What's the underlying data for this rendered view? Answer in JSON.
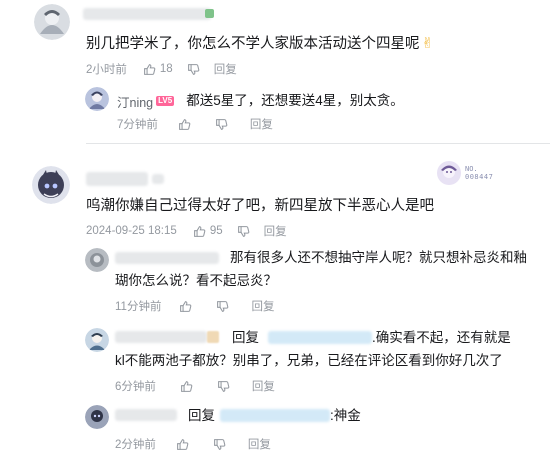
{
  "comments": [
    {
      "text": "别几把学米了，你怎么不学人家版本活动送个四星呢",
      "emoji": "✌",
      "time": "2小时前",
      "likes": "18",
      "reply_label": "回复"
    },
    {
      "text": "呜潮你嫌自己过得太好了吧，新四星放下半恶心人是吧",
      "time": "2024-09-25 18:15",
      "likes": "95",
      "reply_label": "回复",
      "badge_no": "NO.",
      "badge_num": "008447"
    }
  ],
  "replies": [
    {
      "user": "汀ning",
      "level": "LV5",
      "text": "都送5星了，还想要送4星，别太贪。",
      "time": "7分钟前",
      "reply_label": "回复"
    },
    {
      "line1": "那有很多人还不想抽守岸人呢？就只想补忌炎和釉",
      "line2": "瑚你怎么说？看不起忌炎？",
      "time": "11分钟前",
      "reply_label": "回复"
    },
    {
      "reply_prefix": "回复",
      "line1_tail": ".确实看不起，还有就是",
      "line2": "kl不能两池子都放？别串了，兄弟，已经在评论区看到你好几次了",
      "time": "6分钟前",
      "reply_label": "回复"
    },
    {
      "reply_prefix": "回复",
      "tail": ":神金",
      "time": "2分钟前",
      "reply_label": "回复"
    }
  ],
  "icons": [
    "like-icon",
    "dislike-icon"
  ]
}
